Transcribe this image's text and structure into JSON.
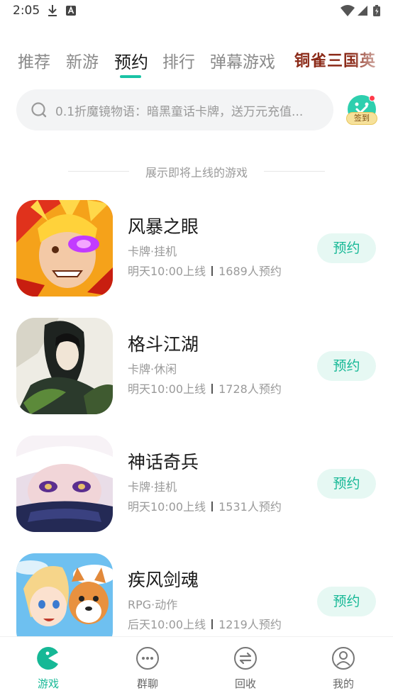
{
  "status_bar": {
    "time": "2:05"
  },
  "tabs": [
    {
      "label": "推荐",
      "active": false
    },
    {
      "label": "新游",
      "active": false
    },
    {
      "label": "预约",
      "active": true
    },
    {
      "label": "排行",
      "active": false
    },
    {
      "label": "弹幕游戏",
      "active": false
    }
  ],
  "brand_tab": {
    "label": "铜雀三国英"
  },
  "search": {
    "placeholder": "0.1折魔镜物语：暗黑童话卡牌，送万元充值..."
  },
  "checkin": {
    "label": "签到"
  },
  "section": {
    "caption": "展示即将上线的游戏"
  },
  "games": [
    {
      "name": "风暴之眼",
      "tags": "卡牌·挂机",
      "release": "明天10:00上线",
      "reservations": "1689人预约",
      "button": "预约"
    },
    {
      "name": "格斗江湖",
      "tags": "卡牌·休闲",
      "release": "明天10:00上线",
      "reservations": "1728人预约",
      "button": "预约"
    },
    {
      "name": "神话奇兵",
      "tags": "卡牌·挂机",
      "release": "明天10:00上线",
      "reservations": "1531人预约",
      "button": "预约"
    },
    {
      "name": "疾风剑魂",
      "tags": "RPG·动作",
      "release": "后天10:00上线",
      "reservations": "1219人预约",
      "button": "预约"
    }
  ],
  "bottom_nav": [
    {
      "label": "游戏",
      "icon": "game-pacman-icon",
      "active": true
    },
    {
      "label": "群聊",
      "icon": "chat-bubble-icon",
      "active": false
    },
    {
      "label": "回收",
      "icon": "recycle-exchange-icon",
      "active": false
    },
    {
      "label": "我的",
      "icon": "profile-icon",
      "active": false
    }
  ],
  "colors": {
    "accent": "#16b896",
    "reserve_bg": "#e6f8f3",
    "search_bg": "#f3f4f5"
  }
}
